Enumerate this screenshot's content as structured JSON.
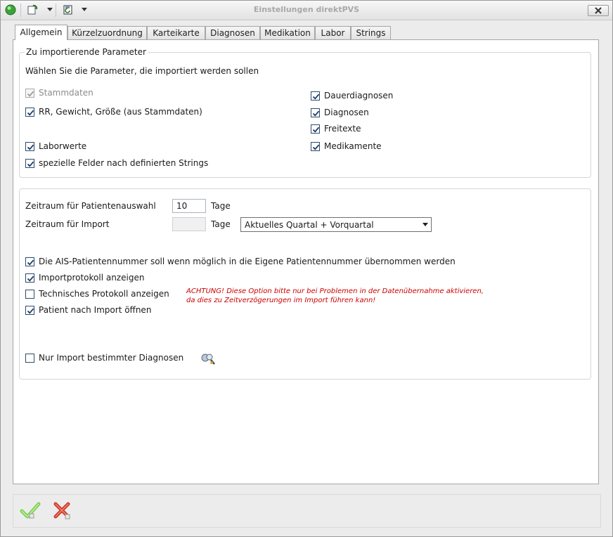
{
  "window": {
    "title": "Einstellungen direktPVS"
  },
  "toolbar": {
    "icons": [
      "status-ok-icon",
      "refresh-icon",
      "save-icon"
    ],
    "close_icon": "close-icon"
  },
  "tabs": [
    {
      "label": "Allgemein",
      "active": true
    },
    {
      "label": "Kürzelzuordnung"
    },
    {
      "label": "Karteikarte"
    },
    {
      "label": "Diagnosen"
    },
    {
      "label": "Medikation"
    },
    {
      "label": "Labor"
    },
    {
      "label": "Strings"
    }
  ],
  "parameters": {
    "legend": "Zu importierende Parameter",
    "intro": "Wählen Sie die Parameter, die importiert werden sollen",
    "left": [
      {
        "label": "Stammdaten",
        "checked": true,
        "disabled": true
      },
      {
        "label": "RR, Gewicht, Größe (aus Stammdaten)",
        "checked": true
      },
      {
        "label": "Laborwerte",
        "checked": true
      },
      {
        "label": "spezielle Felder nach definierten Strings",
        "checked": true
      }
    ],
    "right": [
      {
        "label": "Dauerdiagnosen",
        "checked": true
      },
      {
        "label": "Diagnosen",
        "checked": true
      },
      {
        "label": "Freitexte",
        "checked": true
      },
      {
        "label": "Medikamente",
        "checked": true
      }
    ]
  },
  "zeitraum": {
    "patient_label": "Zeitraum für Patientenauswahl",
    "patient_value": "10",
    "patient_unit": "Tage",
    "import_label": "Zeitraum für Import",
    "import_value": "",
    "import_unit": "Tage",
    "import_select": "Aktuelles Quartal + Vorquartal"
  },
  "options": [
    {
      "label": "Die AIS-Patientennummer soll wenn möglich in die Eigene Patientennummer übernommen werden",
      "checked": true
    },
    {
      "label": "Importprotokoll anzeigen",
      "checked": true
    },
    {
      "label": "Technisches Protokoll anzeigen",
      "checked": false
    },
    {
      "label": "Patient nach Import öffnen",
      "checked": true
    }
  ],
  "warning": {
    "line1": "ACHTUNG! Diese Option bitte nur bei Problemen in der Datenübernahme aktivieren,",
    "line2": "da dies zu Zeitverzögerungen im Import führen kann!",
    "color": "#cc0000"
  },
  "diagnosen_filter": {
    "label": "Nur Import bestimmter Diagnosen",
    "checked": false,
    "icon": "search-config-icon"
  },
  "actions": {
    "ok_icon": "check-icon",
    "cancel_icon": "cancel-x-icon"
  }
}
